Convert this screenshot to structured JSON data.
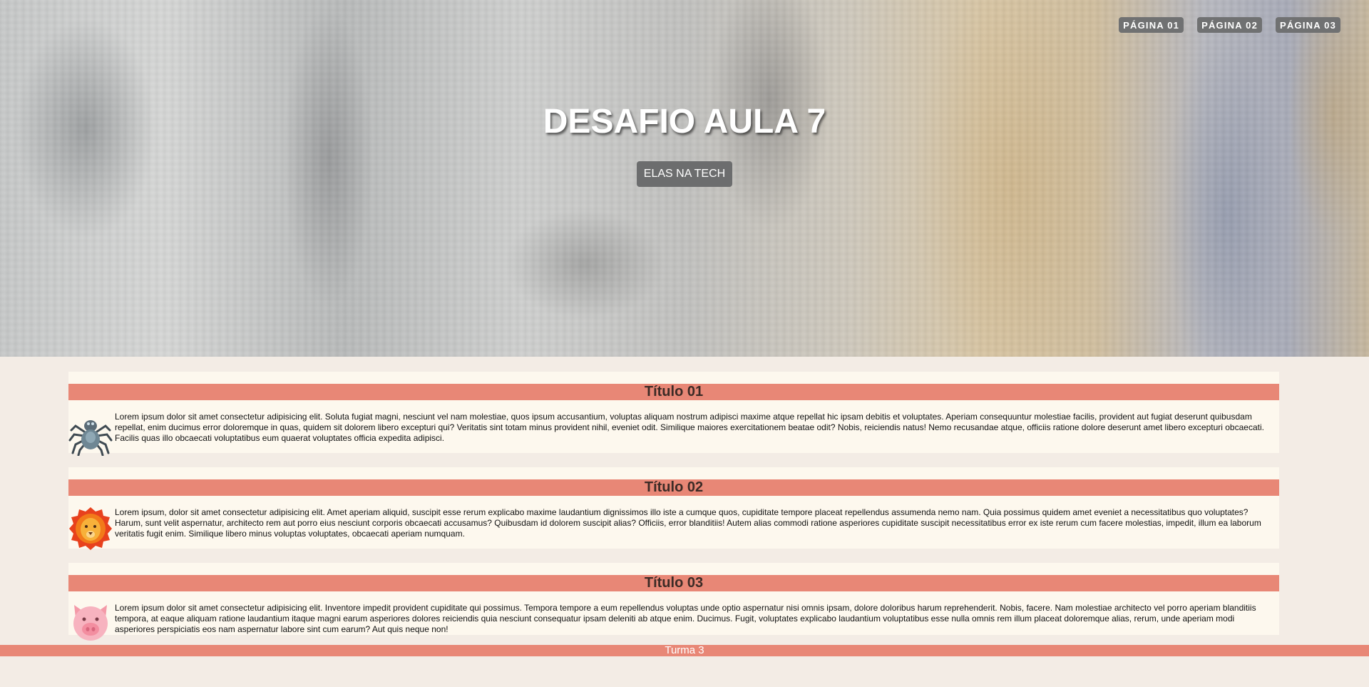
{
  "nav": {
    "items": [
      "PÁGINA 01",
      "PÁGINA 02",
      "PÁGINA 03"
    ]
  },
  "hero": {
    "title": "DESAFIO AULA 7",
    "badge": "ELAS NA TECH"
  },
  "sections": [
    {
      "title": "Título 01",
      "icon": "spider-icon",
      "text": "Lorem ipsum dolor sit amet consectetur adipisicing elit. Soluta fugiat magni, nesciunt vel nam molestiae, quos ipsum accusantium, voluptas aliquam nostrum adipisci maxime atque repellat hic ipsam debitis et voluptates. Aperiam consequuntur molestiae facilis, provident aut fugiat deserunt quibusdam repellat, enim ducimus error doloremque in quas, quidem sit dolorem libero excepturi qui? Veritatis sint totam minus provident nihil, eveniet odit. Similique maiores exercitationem beatae odit? Nobis, reiciendis natus! Nemo recusandae atque, officiis ratione dolore deserunt amet libero excepturi obcaecati. Facilis quas illo obcaecati voluptatibus eum quaerat voluptates officia expedita adipisci."
    },
    {
      "title": "Título 02",
      "icon": "lion-icon",
      "text": "Lorem ipsum, dolor sit amet consectetur adipisicing elit. Amet aperiam aliquid, suscipit esse rerum explicabo maxime laudantium dignissimos illo iste a cumque quos, cupiditate tempore placeat repellendus assumenda nemo nam. Quia possimus quidem amet eveniet a necessitatibus quo voluptates? Harum, sunt velit aspernatur, architecto rem aut porro eius nesciunt corporis obcaecati accusamus? Quibusdam id dolorem suscipit alias? Officiis, error blanditiis! Autem alias commodi ratione asperiores cupiditate suscipit necessitatibus error ex iste rerum cum facere molestias, impedit, illum ea laborum veritatis fugit enim. Similique libero minus voluptas voluptates, obcaecati aperiam numquam."
    },
    {
      "title": "Título 03",
      "icon": "pig-icon",
      "text": "Lorem ipsum dolor sit amet consectetur adipisicing elit. Inventore impedit provident cupiditate qui possimus. Tempora tempore a eum repellendus voluptas unde optio aspernatur nisi omnis ipsam, dolore doloribus harum reprehenderit. Nobis, facere. Nam molestiae architecto vel porro aperiam blanditiis tempora, at eaque aliquam ratione laudantium itaque magni earum asperiores dolores reiciendis quia nesciunt consequatur ipsam deleniti ab atque enim. Ducimus. Fugit, voluptates explicabo laudantium voluptatibus esse nulla omnis rem illum placeat doloremque alias, rerum, unde aperiam modi asperiores perspiciatis eos nam aspernatur labore sint cum earum? Aut quis neque non!"
    }
  ],
  "footer": {
    "text": "Turma 3"
  },
  "colors": {
    "accent": "#e88776",
    "section_bg": "#fdf8ee",
    "page_bg": "#f3ece5",
    "nav_bg": "#707172"
  }
}
